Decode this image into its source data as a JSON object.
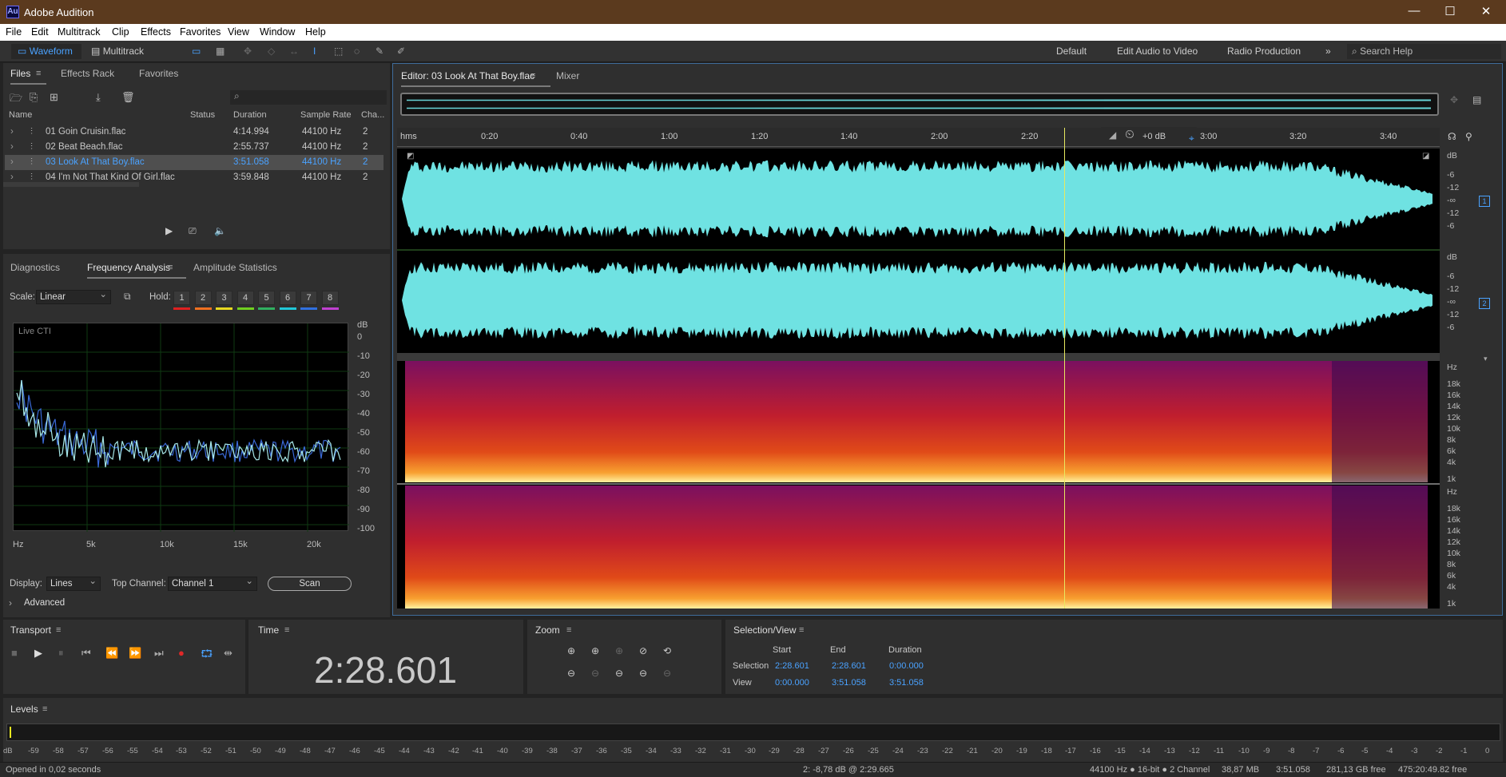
{
  "app": {
    "title": "Adobe Audition",
    "logo": "Au"
  },
  "menu": [
    "File",
    "Edit",
    "Multitrack",
    "Clip",
    "Effects",
    "Favorites",
    "View",
    "Window",
    "Help"
  ],
  "toolbar": {
    "waveform": "Waveform",
    "multitrack": "Multitrack",
    "workspaces": [
      "Default",
      "Edit Audio to Video",
      "Radio Production"
    ],
    "search_placeholder": "Search Help"
  },
  "files_panel": {
    "tabs": [
      "Files",
      "Effects Rack",
      "Favorites"
    ],
    "columns": [
      "Name",
      "Status",
      "Duration",
      "Sample Rate",
      "Cha..."
    ],
    "rows": [
      {
        "name": "01 Goin Cruisin.flac",
        "duration": "4:14.994",
        "rate": "44100 Hz",
        "ch": "2"
      },
      {
        "name": "02 Beat Beach.flac",
        "duration": "2:55.737",
        "rate": "44100 Hz",
        "ch": "2"
      },
      {
        "name": "03 Look At That Boy.flac",
        "duration": "3:51.058",
        "rate": "44100 Hz",
        "ch": "2"
      },
      {
        "name": "04 I'm Not That Kind Of Girl.flac",
        "duration": "3:59.848",
        "rate": "44100 Hz",
        "ch": "2"
      }
    ]
  },
  "analysis_panel": {
    "tabs": [
      "Diagnostics",
      "Frequency Analysis",
      "Amplitude Statistics"
    ],
    "scale_label": "Scale:",
    "scale_value": "Linear",
    "hold_label": "Hold:",
    "hold": [
      "1",
      "2",
      "3",
      "4",
      "5",
      "6",
      "7",
      "8"
    ],
    "hold_colors": [
      "#e02020",
      "#f07020",
      "#e8d820",
      "#70d020",
      "#30b060",
      "#20c8d8",
      "#3070e0",
      "#c040d0"
    ],
    "live": "Live CTI",
    "db_label": "dB",
    "y_ticks": [
      "0",
      "-10",
      "-20",
      "-30",
      "-40",
      "-50",
      "-60",
      "-70",
      "-80",
      "-90",
      "-100"
    ],
    "x_ticks": [
      "Hz",
      "5k",
      "10k",
      "15k",
      "20k"
    ],
    "display_label": "Display:",
    "display_value": "Lines",
    "top_channel_label": "Top Channel:",
    "top_channel_value": "Channel 1",
    "scan": "Scan",
    "advanced": "Advanced"
  },
  "editor": {
    "tab": "Editor: 03 Look At That Boy.flac",
    "mixer": "Mixer",
    "ruler": [
      "hms",
      "0:20",
      "0:40",
      "1:00",
      "1:20",
      "1:40",
      "2:00",
      "2:20",
      "3:00",
      "3:20",
      "3:40"
    ],
    "gain": "+0 dB",
    "db_ticks": [
      "dB",
      "-6",
      "-12",
      "-∞",
      "-12",
      "-6"
    ],
    "channels": [
      "1",
      "2"
    ],
    "hz_ticks": [
      "Hz",
      "18k",
      "16k",
      "14k",
      "12k",
      "10k",
      "8k",
      "6k",
      "4k",
      "1k"
    ]
  },
  "transport": {
    "title": "Transport"
  },
  "time": {
    "title": "Time",
    "value": "2:28.601"
  },
  "zoom": {
    "title": "Zoom"
  },
  "selection": {
    "title": "Selection/View",
    "headers": [
      "Start",
      "End",
      "Duration"
    ],
    "selection_label": "Selection",
    "selection": [
      "2:28.601",
      "2:28.601",
      "0:00.000"
    ],
    "view_label": "View",
    "view": [
      "0:00.000",
      "3:51.058",
      "3:51.058"
    ]
  },
  "levels": {
    "title": "Levels",
    "ticks": [
      "dB",
      "-59",
      "-58",
      "-57",
      "-56",
      "-55",
      "-54",
      "-53",
      "-52",
      "-51",
      "-50",
      "-49",
      "-48",
      "-47",
      "-46",
      "-45",
      "-44",
      "-43",
      "-42",
      "-41",
      "-40",
      "-39",
      "-38",
      "-37",
      "-36",
      "-35",
      "-34",
      "-33",
      "-32",
      "-31",
      "-30",
      "-29",
      "-28",
      "-27",
      "-26",
      "-25",
      "-24",
      "-23",
      "-22",
      "-21",
      "-20",
      "-19",
      "-18",
      "-17",
      "-16",
      "-15",
      "-14",
      "-13",
      "-12",
      "-11",
      "-10",
      "-9",
      "-8",
      "-7",
      "-6",
      "-5",
      "-4",
      "-3",
      "-2",
      "-1",
      "0"
    ]
  },
  "status": {
    "left": "Opened in 0,02 seconds",
    "cursor": "2: -8,78 dB @ 2:29.665",
    "format": "44100 Hz ● 16-bit ● 2 Channel",
    "size": "38,87 MB",
    "duration": "3:51.058",
    "free": "281,13 GB free",
    "extra": "475:20:49.82 free"
  },
  "playhead_fraction": 0.643
}
